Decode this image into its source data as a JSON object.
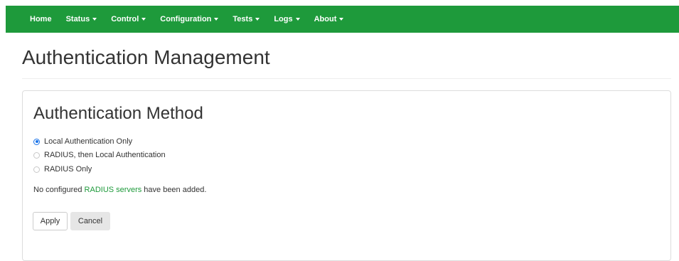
{
  "nav": {
    "items": [
      {
        "label": "Home",
        "dropdown": false
      },
      {
        "label": "Status",
        "dropdown": true
      },
      {
        "label": "Control",
        "dropdown": true
      },
      {
        "label": "Configuration",
        "dropdown": true
      },
      {
        "label": "Tests",
        "dropdown": true
      },
      {
        "label": "Logs",
        "dropdown": true
      },
      {
        "label": "About",
        "dropdown": true
      }
    ],
    "color": "#1e9a3b"
  },
  "page": {
    "title": "Authentication Management"
  },
  "panel": {
    "title": "Authentication Method",
    "options": [
      {
        "label": "Local Authentication Only",
        "checked": true
      },
      {
        "label": "RADIUS, then Local Authentication",
        "checked": false
      },
      {
        "label": "RADIUS Only",
        "checked": false
      }
    ],
    "note_prefix": "No configured ",
    "note_link": "RADIUS servers",
    "note_suffix": " have been added.",
    "apply_label": "Apply",
    "cancel_label": "Cancel"
  }
}
